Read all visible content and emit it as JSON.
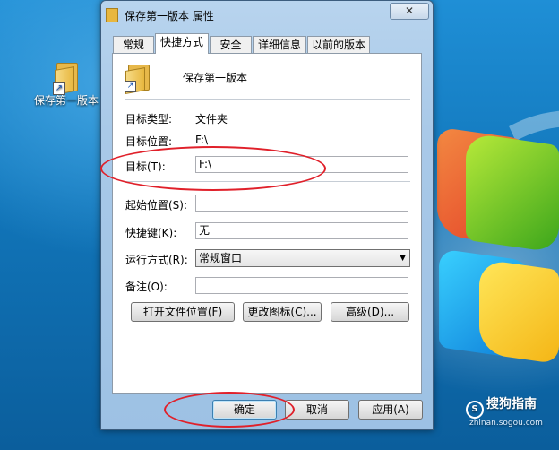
{
  "desktop": {
    "icon_label": "保存第一版本",
    "watermark_text": "搜狗指南",
    "watermark_sub": "zhinan.sogou.com"
  },
  "window": {
    "title": "保存第一版本 属性",
    "close_glyph": "✕"
  },
  "tabs": [
    {
      "label": "常规"
    },
    {
      "label": "快捷方式",
      "active": true
    },
    {
      "label": "安全"
    },
    {
      "label": "详细信息"
    },
    {
      "label": "以前的版本"
    }
  ],
  "shortcut": {
    "name": "保存第一版本",
    "target_type_label": "目标类型:",
    "target_type_value": "文件夹",
    "target_location_label": "目标位置:",
    "target_location_value": "F:\\",
    "target_label": "目标(T):",
    "target_value": "F:\\",
    "start_in_label": "起始位置(S):",
    "start_in_value": "",
    "hotkey_label": "快捷键(K):",
    "hotkey_value": "无",
    "run_label": "运行方式(R):",
    "run_value": "常规窗口",
    "comment_label": "备注(O):",
    "comment_value": "",
    "open_location_button": "打开文件位置(F)",
    "change_icon_button": "更改图标(C)...",
    "advanced_button": "高级(D)..."
  },
  "footer": {
    "ok_button": "确定",
    "cancel_button": "取消",
    "apply_button": "应用(A)"
  },
  "colors": {
    "annotation": "#e0202a",
    "window_frame": "#a9c9e8"
  }
}
